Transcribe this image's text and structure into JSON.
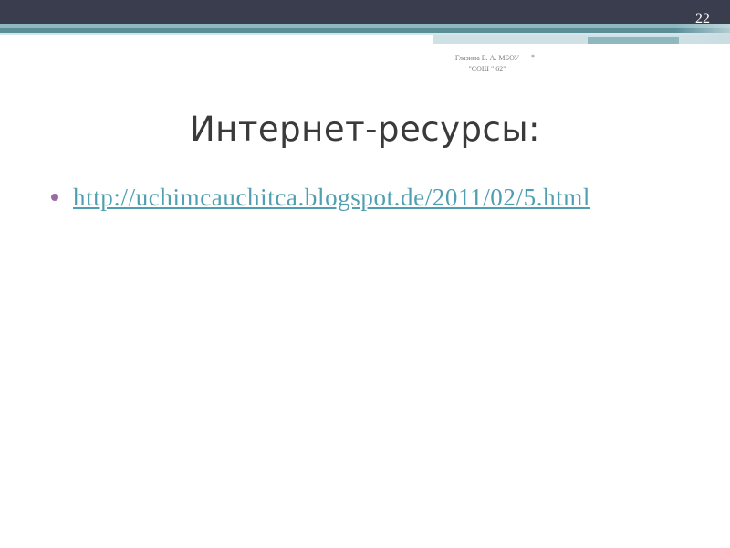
{
  "slide": {
    "number": "22",
    "footer": {
      "author_line1": "Глазина Е. А. МБОУ",
      "author_line2": "\"СОШ \" 62\"",
      "asterisk": "*"
    },
    "title": "Интернет-ресурсы:",
    "bullets": [
      {
        "link_text": "http://uchimcauchitca.blogspot.de/2011/02/5.html"
      }
    ]
  },
  "colors": {
    "top_bar": "#3a3d4d",
    "accent_teal": "#5a8f98",
    "light_teal": "#8fb7bf",
    "bullet": "#9a6aa6",
    "link": "#4f9fb0",
    "text": "#3a3a3a"
  }
}
